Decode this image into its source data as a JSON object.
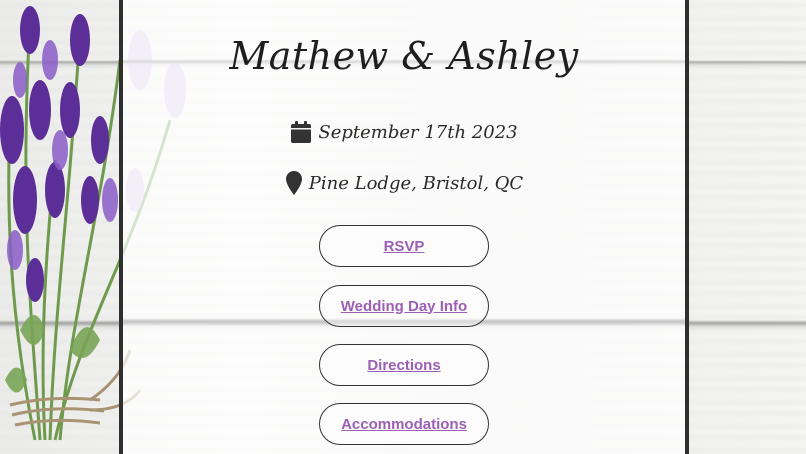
{
  "header": {
    "couple_names": "Mathew & Ashley"
  },
  "event": {
    "date": "September 17th 2023",
    "location": "Pine Lodge, Bristol, QC"
  },
  "icons": {
    "date_icon": "calendar-icon",
    "location_icon": "map-marker-icon"
  },
  "nav": {
    "rsvp_label": "RSVP",
    "wedding_day_info_label": "Wedding Day Info",
    "directions_label": "Directions",
    "accommodations_label": "Accommodations"
  },
  "colors": {
    "link": "#9b5fb5",
    "lavender": "#6a3fa5",
    "panel_border": "#2f2f2f"
  }
}
